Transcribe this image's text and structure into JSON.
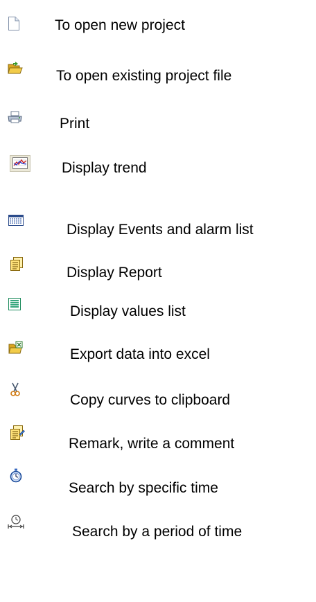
{
  "legend": {
    "items": [
      {
        "icon": "new-document-icon",
        "label": "To open new project"
      },
      {
        "icon": "open-folder-icon",
        "label": "To open existing project file"
      },
      {
        "icon": "printer-icon",
        "label": "Print"
      },
      {
        "icon": "trend-chart-icon",
        "label": "Display trend"
      },
      {
        "icon": "event-list-icon",
        "label": "Display Events and alarm list"
      },
      {
        "icon": "report-icon",
        "label": "Display Report"
      },
      {
        "icon": "values-list-icon",
        "label": "Display values list"
      },
      {
        "icon": "export-excel-icon",
        "label": "Export data into excel"
      },
      {
        "icon": "scissors-icon",
        "label": "Copy curves to clipboard"
      },
      {
        "icon": "remark-icon",
        "label": "Remark, write a comment"
      },
      {
        "icon": "stopwatch-icon",
        "label": "Search by specific time"
      },
      {
        "icon": "time-period-icon",
        "label": "Search by a period of time"
      }
    ]
  }
}
